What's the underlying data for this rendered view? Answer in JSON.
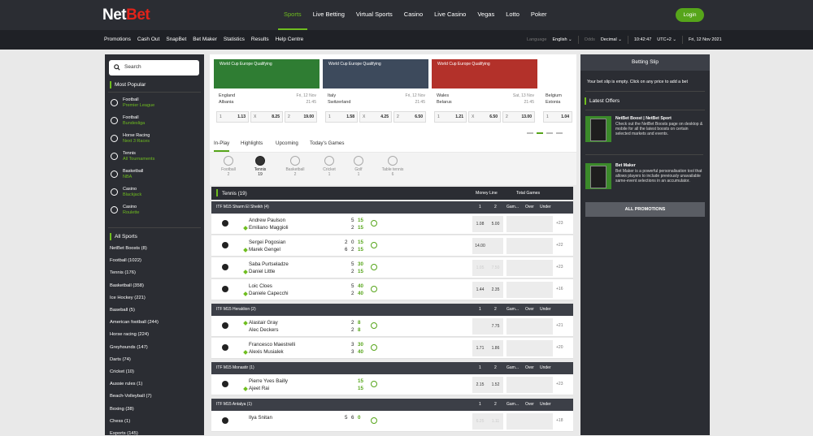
{
  "brand": {
    "net": "Net",
    "bet": "Bet"
  },
  "main_nav": [
    "Sports",
    "Live Betting",
    "Virtual Sports",
    "Casino",
    "Live Casino",
    "Vegas",
    "Lotto",
    "Poker"
  ],
  "login_label": "Login",
  "sub_nav": [
    "Promotions",
    "Cash Out",
    "SnapBet",
    "Bet Maker",
    "Statistics",
    "Results",
    "Help Centre"
  ],
  "prefs": {
    "language_label": "Language",
    "language": "English",
    "odds_label": "Odds",
    "odds": "Decimal",
    "time": "10:42:47",
    "tz": "UTC+2",
    "date": "Fri, 12 Nov 2021"
  },
  "search_placeholder": "Search",
  "most_popular": {
    "title": "Most Popular",
    "items": [
      {
        "name": "Football",
        "sub": "Premier League",
        "icon": "football-icon"
      },
      {
        "name": "Football",
        "sub": "Bundesliga",
        "icon": "football-icon"
      },
      {
        "name": "Horse Racing",
        "sub": "Next 3 Races",
        "icon": "horse-icon"
      },
      {
        "name": "Tennis",
        "sub": "All Tournaments",
        "icon": "tennis-icon"
      },
      {
        "name": "Basketball",
        "sub": "NBA",
        "icon": "basketball-icon"
      },
      {
        "name": "Casino",
        "sub": "Blackjack",
        "icon": "casino-icon"
      },
      {
        "name": "Casino",
        "sub": "Roulette",
        "icon": "casino-icon"
      }
    ]
  },
  "all_sports": {
    "title": "All Sports",
    "items": [
      "NetBet Boosts (8)",
      "Football (1022)",
      "Tennis (176)",
      "Basketball (358)",
      "Ice Hockey (221)",
      "Baseball (5)",
      "American football (244)",
      "Horse racing (224)",
      "Greyhounds (147)",
      "Darts (74)",
      "Cricket (10)",
      "Aussie rules (1)",
      "Beach-Volleyball (7)",
      "Boxing (38)",
      "Chess (1)",
      "Esports (145)"
    ]
  },
  "featured": [
    {
      "caption": "World Cup Europe Qualifying",
      "home": "England",
      "away": "Albania",
      "date": "Fri, 12 Nov",
      "time": "21:45",
      "odds": [
        [
          "1",
          "1.13"
        ],
        [
          "X",
          "8.25"
        ],
        [
          "2",
          "19.00"
        ]
      ],
      "bg": "#2f7d33"
    },
    {
      "caption": "World Cup Europe Qualifying",
      "home": "Italy",
      "away": "Switzerland",
      "date": "Fri, 12 Nov",
      "time": "21:45",
      "odds": [
        [
          "1",
          "1.58"
        ],
        [
          "X",
          "4.25"
        ],
        [
          "2",
          "6.50"
        ]
      ],
      "bg": "#3d4a5c"
    },
    {
      "caption": "World Cup Europe Qualifying",
      "home": "Wales",
      "away": "Belarus",
      "date": "Sat, 13 Nov",
      "time": "21:45",
      "odds": [
        [
          "1",
          "1.21"
        ],
        [
          "X",
          "6.50"
        ],
        [
          "2",
          "13.00"
        ]
      ],
      "bg": "#b3312a"
    },
    {
      "caption": "",
      "home": "Belgium",
      "away": "Estonia",
      "date": "",
      "time": "",
      "odds": [
        [
          "1",
          "1.04"
        ]
      ],
      "bg": "#ffffff"
    }
  ],
  "tabs": [
    "In-Play",
    "Highlights",
    "Upcoming",
    "Today's Games"
  ],
  "sport_icons": [
    {
      "name": "Football",
      "count": "2"
    },
    {
      "name": "Tennis",
      "count": "19"
    },
    {
      "name": "Basketball",
      "count": "2"
    },
    {
      "name": "Cricket",
      "count": "1"
    },
    {
      "name": "Golf",
      "count": "1"
    },
    {
      "name": "Table tennis",
      "count": "6"
    }
  ],
  "tennis_header": {
    "title": "Tennis",
    "count": "(19)",
    "money_line": "Money Line",
    "total_games": "Total Games"
  },
  "col_labels": {
    "one": "1",
    "two": "2",
    "games": "Gam...",
    "over": "Over",
    "under": "Under"
  },
  "groups": [
    {
      "name": "ITF M15 Sharm El Sheikh (4)",
      "matches": [
        {
          "p1": "Andrew Paulson",
          "p2": "Emiliano Maggioli",
          "serve": 2,
          "s1": [
            "5",
            "15"
          ],
          "s2": [
            "2",
            "15"
          ],
          "o1": "1.08",
          "o2": "5.00",
          "dim": false,
          "more": "+23"
        },
        {
          "p1": "Sergei Pogosian",
          "p2": "Marek Gengel",
          "serve": 2,
          "s1": [
            "2",
            "0",
            "15"
          ],
          "s2": [
            "6",
            "2",
            "15"
          ],
          "o1": "14.00",
          "o2": "",
          "dim": false,
          "more": "+22"
        },
        {
          "p1": "Saba Purtseladze",
          "p2": "Daniel Little",
          "serve": 2,
          "s1": [
            "5",
            "30"
          ],
          "s2": [
            "2",
            "15"
          ],
          "o1": "1.05",
          "o2": "7.50",
          "dim": true,
          "more": "+23"
        },
        {
          "p1": "Loic Cloes",
          "p2": "Daniele Capecchi",
          "serve": 2,
          "s1": [
            "5",
            "40"
          ],
          "s2": [
            "2",
            "40"
          ],
          "o1": "1.44",
          "o2": "2.35",
          "dim": false,
          "more": "+16"
        }
      ]
    },
    {
      "name": "ITF M15 Heraklion (2)",
      "matches": [
        {
          "p1": "Alastair Gray",
          "p2": "Alec Deckers",
          "serve": 1,
          "s1": [
            "2",
            "8"
          ],
          "s2": [
            "2",
            "8"
          ],
          "o1": "",
          "o2": "7.75",
          "dim": false,
          "more": "+21"
        },
        {
          "p1": "Francesco Maestrelli",
          "p2": "Alexis Musialek",
          "serve": 2,
          "s1": [
            "3",
            "30"
          ],
          "s2": [
            "3",
            "40"
          ],
          "o1": "1.71",
          "o2": "1.86",
          "dim": false,
          "more": "+20"
        }
      ]
    },
    {
      "name": "ITF M15 Monastir (1)",
      "matches": [
        {
          "p1": "Pierre Yves Bailly",
          "p2": "Ajeet Rai",
          "serve": 2,
          "s1": [
            "15"
          ],
          "s2": [
            "15"
          ],
          "o1": "2.15",
          "o2": "1.52",
          "dim": false,
          "more": "+23"
        }
      ]
    },
    {
      "name": "ITF M15 Antalya (1)",
      "matches": [
        {
          "p1": "Ilya Snitan",
          "p2": "",
          "serve": 0,
          "s1": [
            "5",
            "6",
            "0"
          ],
          "s2": [],
          "o1": "6.25",
          "o2": "1.11",
          "dim": true,
          "more": "+18"
        }
      ]
    }
  ],
  "betting_slip": {
    "title": "Betting Slip",
    "message": "Your bet slip is empty. Click on any price to add a bet"
  },
  "latest_offers": {
    "title": "Latest Offers",
    "items": [
      {
        "title": "NetBet Boost | NetBet Sport",
        "desc": "Check out the NetBet Boosts page on desktop & mobile for all the latest boosts on certain selected markets and events."
      },
      {
        "title": "Bet Maker",
        "desc": "Bet Maker is a powerful personalisation tool that allows players to include previously unavailable same-event selections in an accumulator."
      }
    ],
    "all_label": "ALL PROMOTIONS"
  }
}
